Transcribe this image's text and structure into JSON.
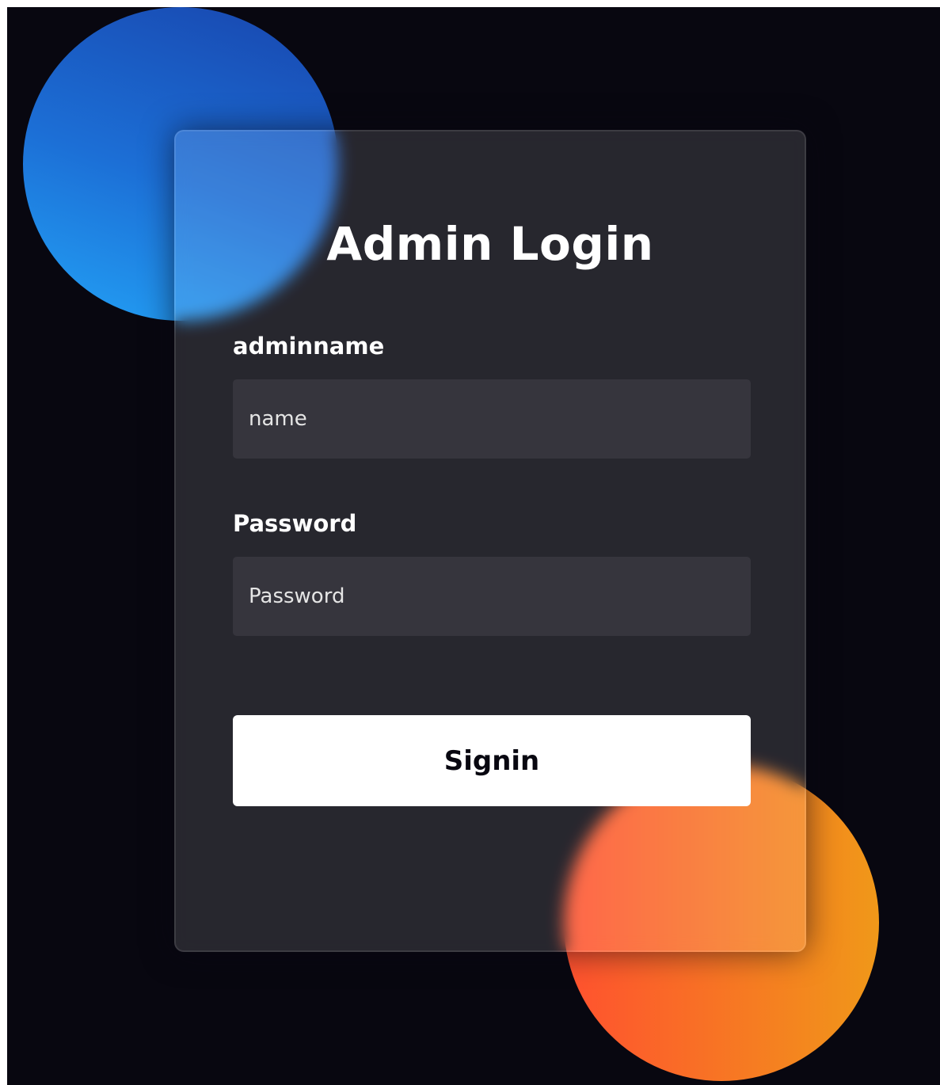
{
  "login": {
    "title": "Admin Login",
    "username_label": "adminname",
    "username_placeholder": "name",
    "password_label": "Password",
    "password_placeholder": "Password",
    "submit_label": "Signin"
  },
  "colors": {
    "background": "#080710",
    "blue_blob_start": "#1845ad",
    "blue_blob_end": "#23a2f6",
    "orange_blob_start": "#ff512f",
    "orange_blob_end": "#f09819",
    "button_bg": "#ffffff",
    "button_text": "#080710"
  }
}
